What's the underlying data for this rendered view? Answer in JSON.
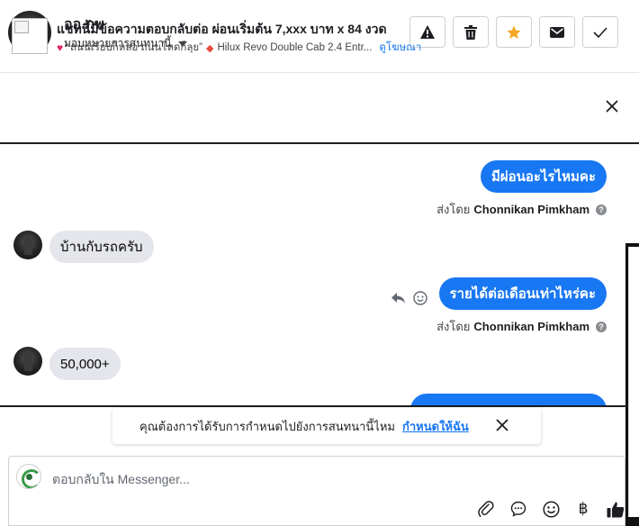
{
  "header": {
    "contact_name": "ออ ภพ",
    "assign_label": "มอบหมายการสนทนานี้",
    "buttons": [
      {
        "name": "report",
        "icon": "warning-icon"
      },
      {
        "name": "delete",
        "icon": "trash-icon"
      },
      {
        "name": "star",
        "icon": "star-icon",
        "color": "#f5a623"
      },
      {
        "name": "mark-unread",
        "icon": "envelope-icon"
      },
      {
        "name": "mark-done",
        "icon": "checkmark-icon"
      }
    ]
  },
  "ad_banner": {
    "title": "แชทนี้มีข้อความตอบกลับต่อ ผ่อนเริ่มต้น 7,xxx บาท x 84 งวด",
    "subtitle": "“ถนนเรียบก็หล่อ ถนนโหดก็ลุย”",
    "vehicle": "Hilux Revo Double Cab 2.4 Entr...",
    "view_ad_link": "ดูโฆษณา"
  },
  "messages": [
    {
      "direction": "out",
      "text": "มีผ่อนอะไรไหมคะ",
      "sent_by_label": "ส่งโดย",
      "sender": "Chonnikan Pimkham"
    },
    {
      "direction": "in",
      "text": "บ้านกับรถครับ"
    },
    {
      "direction": "out",
      "text": "รายได้ต่อเดือนเท่าไหร่คะ",
      "sent_by_label": "ส่งโดย",
      "sender": "Chonnikan Pimkham"
    },
    {
      "direction": "in",
      "text": "50,000+"
    }
  ],
  "assign_prompt": {
    "question": "คุณต้องการได้รับการกำหนดไปยังการสนทนานี้ไหม",
    "action": "กำหนดให้ฉัน"
  },
  "composer": {
    "placeholder": "ตอบกลับใน Messenger...",
    "icons": [
      "paperclip-icon",
      "saved-reply-icon",
      "emoji-icon",
      "baht-icon",
      "thumbs-up-icon"
    ]
  },
  "colors": {
    "accent": "#1877f2",
    "star": "#f5a623",
    "incoming_bubble": "#e4e6eb"
  }
}
